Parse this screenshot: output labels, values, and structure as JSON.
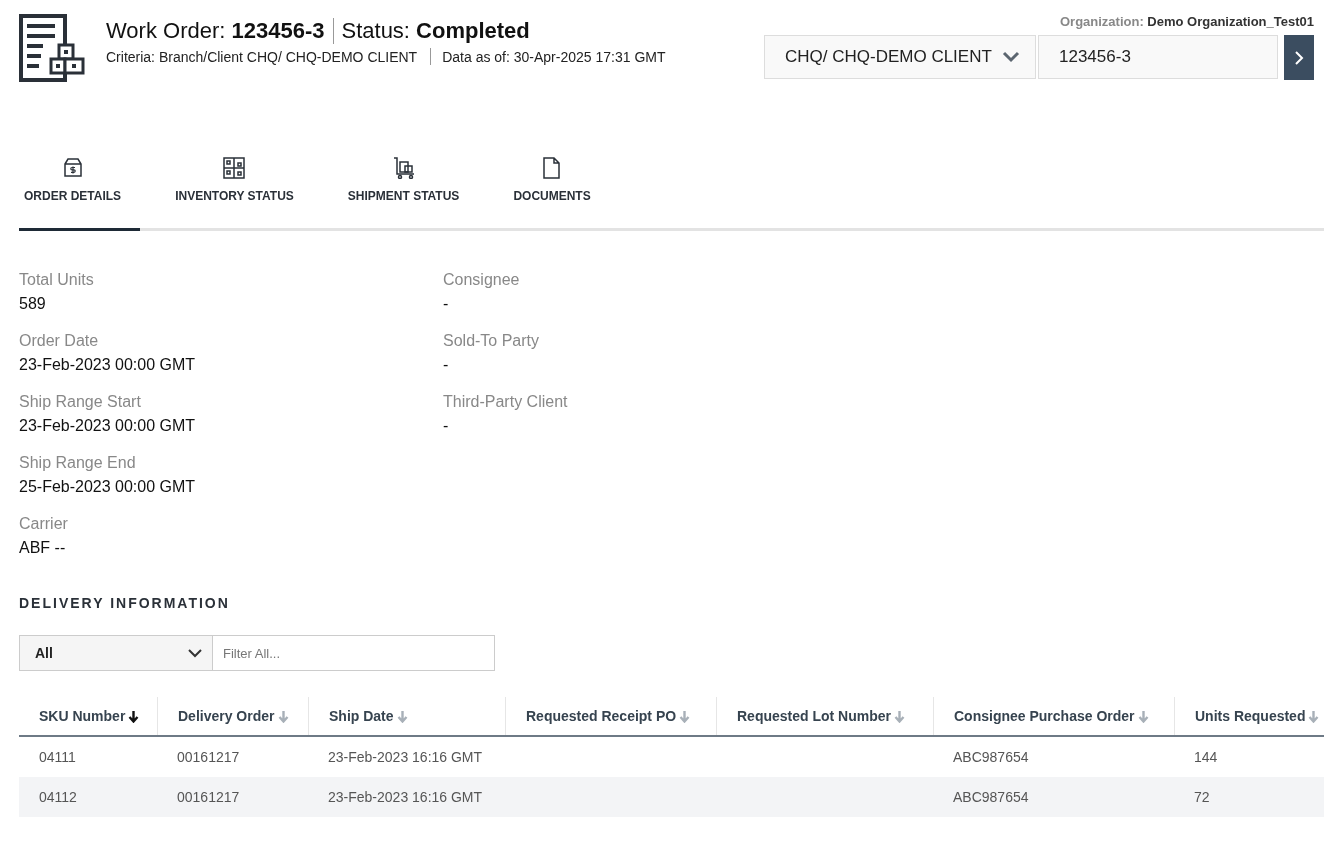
{
  "header": {
    "title_label": "Work Order:",
    "order_number": "123456-3",
    "status_label": "Status:",
    "status": "Completed",
    "criteria": "Criteria: Branch/Client CHQ/ CHQ-DEMO CLIENT",
    "data_as_of": "Data as of: 30-Apr-2025 17:31 GMT",
    "organization_label": "Organization:",
    "organization": "Demo Organization_Test01",
    "client_select": "CHQ/ CHQ-DEMO CLIENT",
    "order_field": "123456-3"
  },
  "tabs": [
    {
      "label": "ORDER DETAILS",
      "selected": true
    },
    {
      "label": "INVENTORY STATUS",
      "selected": false
    },
    {
      "label": "SHIPMENT STATUS",
      "selected": false
    },
    {
      "label": "DOCUMENTS",
      "selected": false
    }
  ],
  "details": {
    "left": [
      {
        "label": "Total Units",
        "value": "589"
      },
      {
        "label": "Order Date",
        "value": "23-Feb-2023 00:00 GMT"
      },
      {
        "label": "Ship Range Start",
        "value": "23-Feb-2023 00:00 GMT"
      },
      {
        "label": "Ship Range End",
        "value": "25-Feb-2023 00:00 GMT"
      },
      {
        "label": "Carrier",
        "value": "ABF --"
      }
    ],
    "right": [
      {
        "label": "Consignee",
        "value": "-"
      },
      {
        "label": "Sold-To Party",
        "value": "-"
      },
      {
        "label": "Third-Party Client",
        "value": "-"
      }
    ]
  },
  "delivery": {
    "title": "DELIVERY INFORMATION",
    "filter_select": "All",
    "filter_placeholder": "Filter All...",
    "columns": [
      {
        "label": "SKU Number",
        "sorted": true
      },
      {
        "label": "Delivery Order",
        "sorted": false
      },
      {
        "label": "Ship Date",
        "sorted": false
      },
      {
        "label": "Requested Receipt PO",
        "sorted": false
      },
      {
        "label": "Requested Lot Number",
        "sorted": false
      },
      {
        "label": "Consignee Purchase Order",
        "sorted": false
      },
      {
        "label": "Units Requested",
        "sorted": false
      }
    ],
    "rows": [
      [
        "04111",
        "00161217",
        "23-Feb-2023 16:16 GMT",
        "",
        "",
        "ABC987654",
        "144"
      ],
      [
        "04112",
        "00161217",
        "23-Feb-2023 16:16 GMT",
        "",
        "",
        "ABC987654",
        "72"
      ]
    ]
  }
}
